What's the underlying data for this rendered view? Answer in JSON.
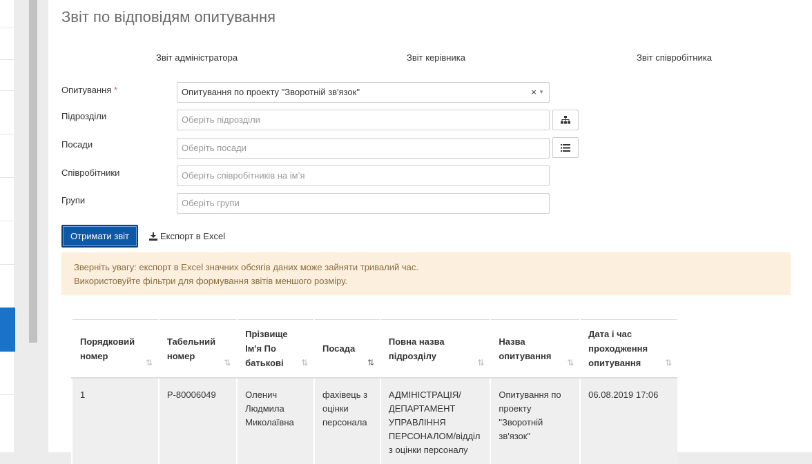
{
  "page": {
    "title": "Звіт по відповідям опитування"
  },
  "tabs": [
    {
      "label": "Звіт адміністратора"
    },
    {
      "label": "Звіт керівника"
    },
    {
      "label": "Звіт співробітника"
    }
  ],
  "form": {
    "survey": {
      "label": "Опитування",
      "required_mark": "*",
      "value": "Опитування по проекту \"Зворотній зв'язок\"",
      "clear": "×",
      "arrow": "▼"
    },
    "divisions": {
      "label": "Підрозділи",
      "placeholder": "Оберіть підрозділи",
      "button_icon": "org-chart-icon"
    },
    "positions": {
      "label": "Посади",
      "placeholder": "Оберіть посади",
      "button_icon": "list-icon"
    },
    "employees": {
      "label": "Співробітники",
      "placeholder": "Оберіть співробітників на ім’я"
    },
    "groups": {
      "label": "Групи",
      "placeholder": "Оберіть групи"
    }
  },
  "actions": {
    "get_report": "Отримати звіт",
    "export_excel": "Експорт в Excel",
    "export_icon": "download-icon"
  },
  "notice": {
    "line1": "Зверніть увагу: експорт в Excel значних обсягів даних може зайняти тривалий час.",
    "line2": "Використовуйте фільтри для формування звітів меншого розміру."
  },
  "table": {
    "columns": [
      {
        "label": "Порядковий номер",
        "sort": "⇅"
      },
      {
        "label": "Табельний номер",
        "sort": "⇅"
      },
      {
        "label": "Прізвище Ім'я По батькові",
        "sort": "⇅"
      },
      {
        "label": "Посада",
        "sort": "⇅"
      },
      {
        "label": "Повна назва підрозділу",
        "sort": "⇅"
      },
      {
        "label": "Назва опитування",
        "sort": "⇅"
      },
      {
        "label": "Дата і час проходження опитування",
        "sort": "⇅"
      }
    ],
    "rows": [
      [
        "1",
        "P-80006049",
        "Оленич Людмила Миколаївна",
        "фахівець з оцінки персонала",
        "АДМІНІСТРАЦІЯ/ ДЕПАРТАМЕНТ УПРАВЛІННЯ ПЕРСОНАЛОМ/відділ з оцінки персоналу",
        "Опитування по проекту \"Зворотній зв'язок\"",
        "06.08.2019 17:06"
      ]
    ]
  },
  "colors": {
    "primary": "#0e58a8",
    "notice_bg": "#fcefde",
    "notice_text": "#8a6d3b",
    "active_sidebar": "#1a73c9"
  }
}
